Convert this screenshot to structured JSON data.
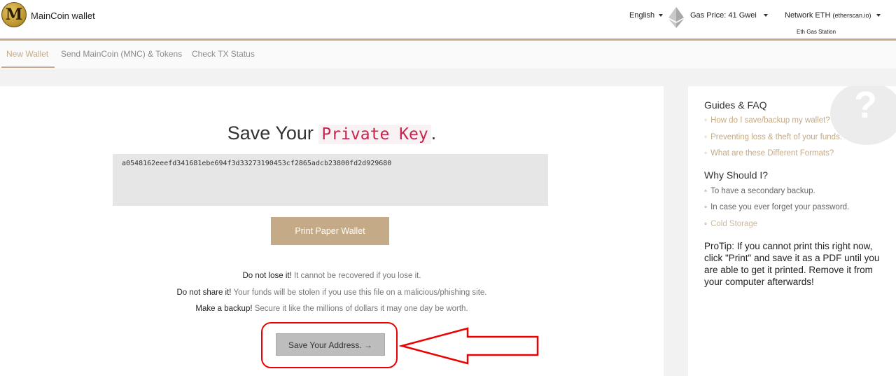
{
  "header": {
    "logo_letter": "M",
    "brand": "MainCoin wallet",
    "language": "English",
    "gas_price": "Gas Price: 41 Gwei",
    "network": "Network ETH",
    "network_source": "(etherscan.io)",
    "gas_station": "Eth Gas Station"
  },
  "nav": {
    "tabs": [
      {
        "label": "New Wallet",
        "active": true
      },
      {
        "label": "Send MainCoin (MNC) & Tokens",
        "active": false
      },
      {
        "label": "Check TX Status",
        "active": false
      }
    ]
  },
  "main": {
    "title_prefix": "Save Your ",
    "title_code": "Private Key",
    "title_suffix": ".",
    "private_key": "a0548162eeefd341681ebe694f3d33273190453cf2865adcb23800fd2d929680",
    "print_button": "Print Paper Wallet",
    "warnings": [
      {
        "bold": "Do not lose it!",
        "text": " It cannot be recovered if you lose it."
      },
      {
        "bold": "Do not share it!",
        "text": " Your funds will be stolen if you use this file on a malicious/phishing site."
      },
      {
        "bold": "Make a backup!",
        "text": " Secure it like the millions of dollars it may one day be worth."
      }
    ],
    "save_address_button": "Save Your Address. →"
  },
  "sidebar": {
    "question_mark": "?",
    "guides_title": "Guides & FAQ",
    "guides": [
      "How do I save/backup my wallet?",
      "Preventing loss & theft of your funds.",
      "What are these Different Formats?"
    ],
    "why_title": "Why Should I?",
    "why_items": [
      "To have a secondary backup.",
      "In case you ever forget your password.",
      "Cold Storage"
    ],
    "protip": "ProTip: If you cannot print this right now, click \"Print\" and save it as a PDF until you are able to get it printed. Remove it from your computer afterwards!"
  },
  "colors": {
    "accent": "#c4aa86",
    "highlight": "#e00000",
    "code": "#c7254e"
  }
}
